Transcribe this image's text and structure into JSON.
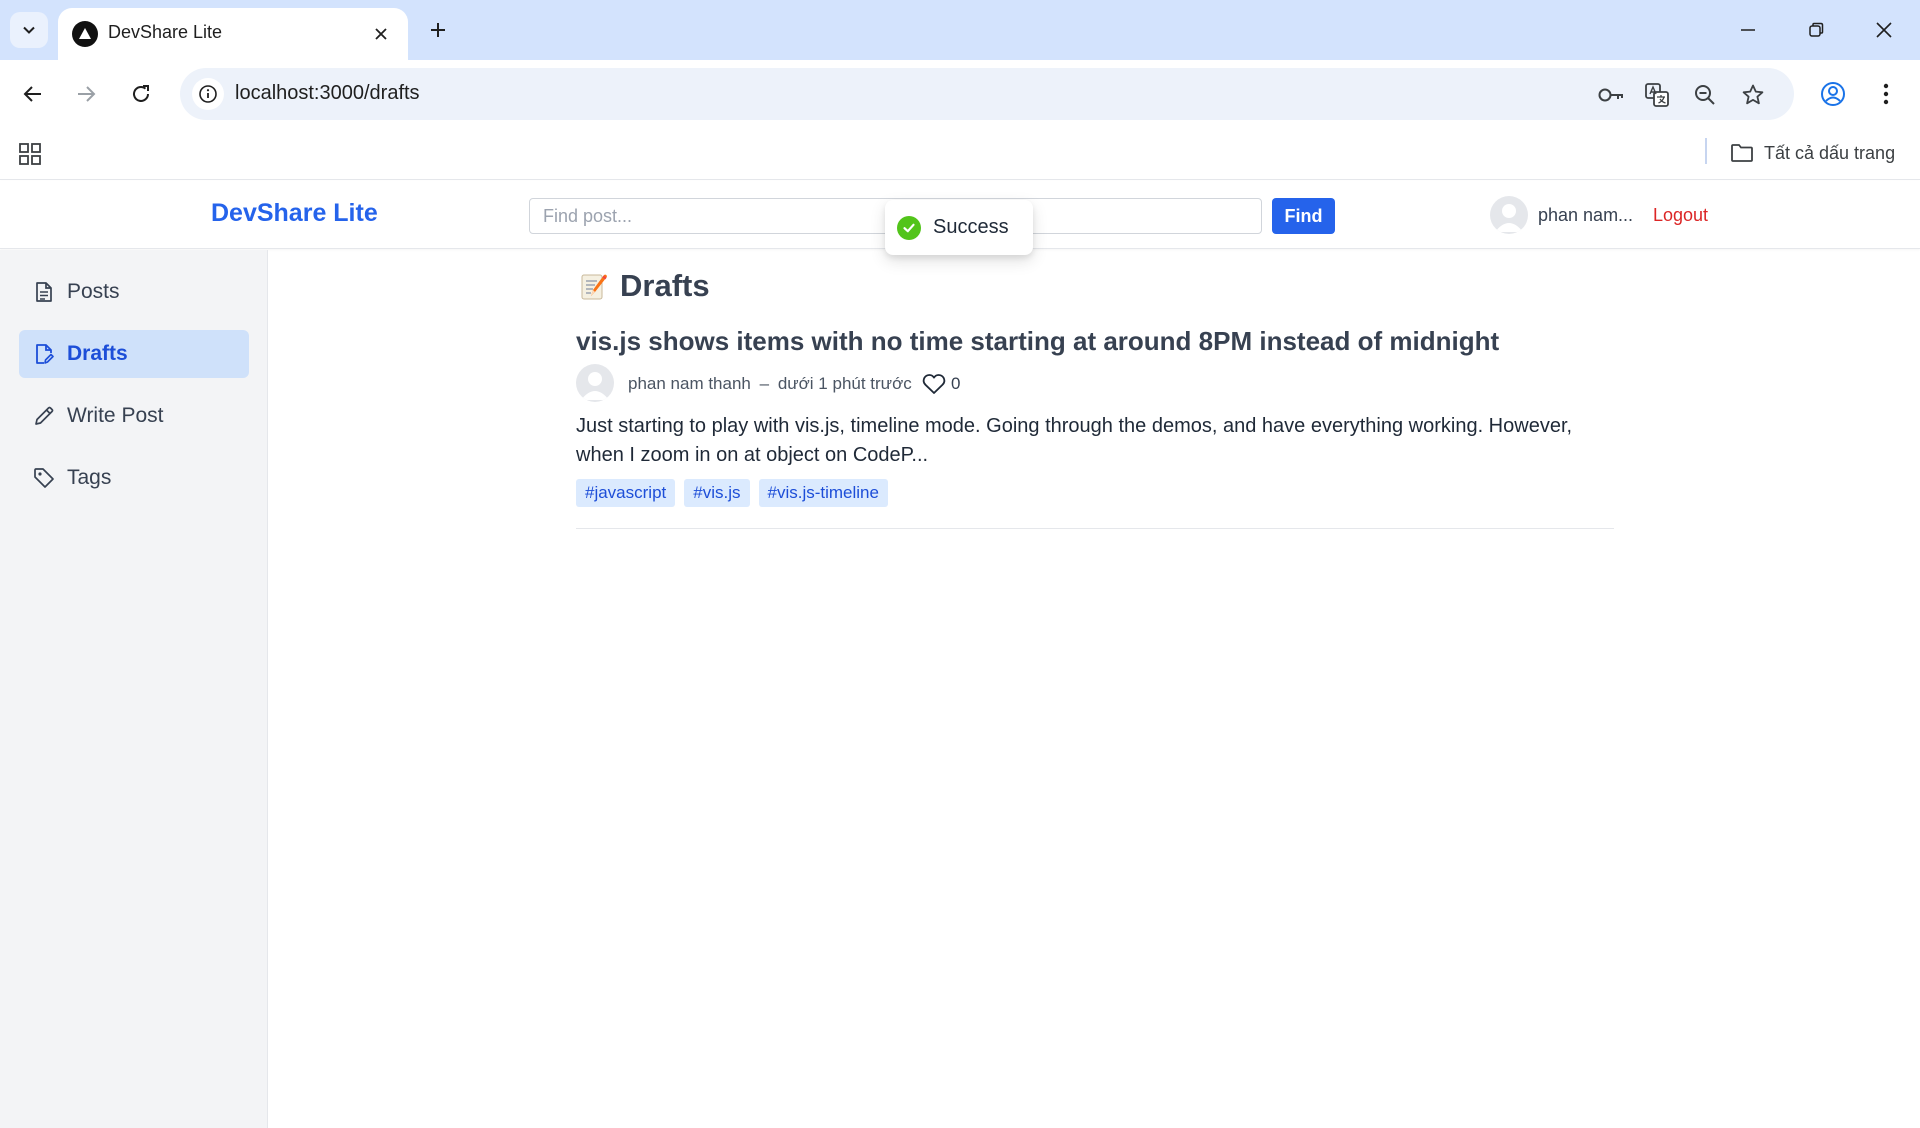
{
  "browser": {
    "tab_title": "DevShare Lite",
    "url": "localhost:3000/drafts",
    "all_bookmarks_label": "Tất cả dấu trang",
    "icons": {
      "tab_search": "chevron-down-icon",
      "favicon": "triangle-logo-icon",
      "close_tab": "close-icon",
      "new_tab": "plus-icon",
      "back": "arrow-left-icon",
      "forward": "arrow-right-icon",
      "reload": "reload-icon",
      "site_info": "info-icon",
      "password": "key-icon",
      "translate": "translate-icon",
      "zoom": "zoom-out-icon",
      "bookmark": "star-icon",
      "profile": "profile-icon",
      "menu": "kebab-menu-icon",
      "apps": "apps-grid-icon",
      "folder": "folder-icon"
    }
  },
  "header": {
    "brand": "DevShare Lite",
    "search_placeholder": "Find post...",
    "search_value": "",
    "find_label": "Find",
    "user_name": "phan nam...",
    "logout_label": "Logout"
  },
  "sidebar": {
    "items": [
      {
        "label": "Posts",
        "icon": "document-icon",
        "active": false
      },
      {
        "label": "Drafts",
        "icon": "document-edit-icon",
        "active": true
      },
      {
        "label": "Write Post",
        "icon": "pencil-icon",
        "active": false
      },
      {
        "label": "Tags",
        "icon": "tag-icon",
        "active": false
      }
    ]
  },
  "main": {
    "title": "Drafts",
    "title_icon": "memo-icon",
    "posts": [
      {
        "title": "vis.js shows items with no time starting at around 8PM instead of midnight",
        "author": "phan nam thanh",
        "separator": "–",
        "time": "dưới 1 phút trước",
        "likes": "0",
        "excerpt": "Just starting to play with vis.js, timeline mode. Going through the demos, and have everything working. However, when I zoom in on at object on CodeP...",
        "tags": [
          "#javascript",
          "#vis.js",
          "#vis.js-timeline"
        ]
      }
    ]
  },
  "toast": {
    "message": "Success",
    "icon": "check-circle-icon"
  },
  "colors": {
    "accent": "#2563eb",
    "logout": "#dc2626",
    "sidebar_bg": "#f3f4f6",
    "sidebar_active_bg": "#cfe1fa",
    "tag_bg": "#dbeafe",
    "success": "#52c41a",
    "chrome_tabstrip": "#d3e3fd"
  }
}
